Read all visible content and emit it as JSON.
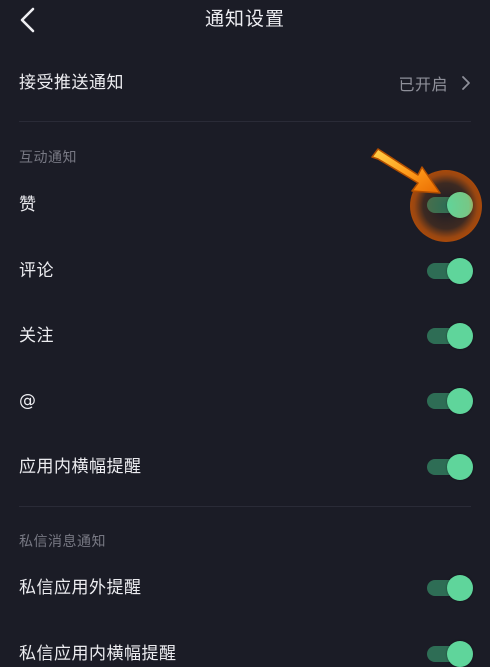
{
  "header": {
    "title": "通知设置",
    "back_icon": "chevron-left-icon"
  },
  "push": {
    "label": "接受推送通知",
    "value": "已开启",
    "chevron_icon": "chevron-right-icon"
  },
  "sections": [
    {
      "title": "互动通知",
      "items": [
        {
          "label": "赞",
          "enabled": true
        },
        {
          "label": "评论",
          "enabled": true
        },
        {
          "label": "关注",
          "enabled": true
        },
        {
          "label": "@",
          "enabled": true
        },
        {
          "label": "应用内横幅提醒",
          "enabled": true
        }
      ]
    },
    {
      "title": "私信消息通知",
      "items": [
        {
          "label": "私信应用外提醒",
          "enabled": true
        },
        {
          "label": "私信应用内横幅提醒",
          "enabled": true
        }
      ]
    }
  ],
  "colors": {
    "background": "#1b1c26",
    "toggle_on_knob": "#5fd59b",
    "toggle_on_track": "#2e6d55",
    "highlight": "#ff7a00"
  },
  "annotation": {
    "arrow_icon": "pointer-arrow-icon",
    "highlight_target": "赞"
  }
}
